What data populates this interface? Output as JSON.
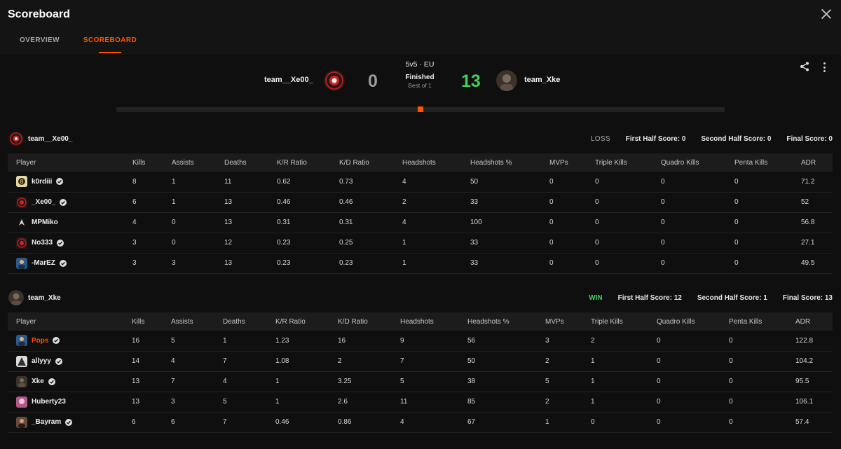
{
  "header": {
    "title": "Scoreboard"
  },
  "tabs": [
    {
      "label": "OVERVIEW",
      "active": false
    },
    {
      "label": "SCOREBOARD",
      "active": true
    }
  ],
  "match": {
    "format": "5v5 · EU",
    "status": "Finished",
    "best_of": "Best of 1",
    "team1": {
      "name": "team__Xe00_",
      "score": "0"
    },
    "team2": {
      "name": "team_Xke",
      "score": "13"
    },
    "colors": {
      "accent": "#ff5500",
      "win": "#3fd15b",
      "loss_score": "#9b9b9b"
    }
  },
  "columns": [
    "Player",
    "Kills",
    "Assists",
    "Deaths",
    "K/R Ratio",
    "K/D Ratio",
    "Headshots",
    "Headshots %",
    "MVPs",
    "Triple Kills",
    "Quadro Kills",
    "Penta Kills",
    "ADR"
  ],
  "teams": [
    {
      "name": "team__Xe00_",
      "result": "LOSS",
      "first_half": "First Half Score: 0",
      "second_half": "Second Half Score: 0",
      "final": "Final Score: 0",
      "players": [
        {
          "name": "k0rdiii",
          "verified": true,
          "highlight": false,
          "avatar": "gold",
          "stats": [
            "8",
            "1",
            "11",
            "0.62",
            "0.73",
            "4",
            "50",
            "0",
            "0",
            "0",
            "0",
            "71.2"
          ]
        },
        {
          "name": "_Xe00_",
          "verified": true,
          "highlight": false,
          "avatar": "red",
          "stats": [
            "6",
            "1",
            "13",
            "0.46",
            "0.46",
            "2",
            "33",
            "0",
            "0",
            "0",
            "0",
            "52"
          ]
        },
        {
          "name": "MPMiko",
          "verified": false,
          "highlight": false,
          "avatar": "wings",
          "stats": [
            "4",
            "0",
            "13",
            "0.31",
            "0.31",
            "4",
            "100",
            "0",
            "0",
            "0",
            "0",
            "56.8"
          ]
        },
        {
          "name": "No333",
          "verified": true,
          "highlight": false,
          "avatar": "red",
          "stats": [
            "3",
            "0",
            "12",
            "0.23",
            "0.25",
            "1",
            "33",
            "0",
            "0",
            "0",
            "0",
            "27.1"
          ]
        },
        {
          "name": "-MarEZ",
          "verified": true,
          "highlight": false,
          "avatar": "blue",
          "stats": [
            "3",
            "3",
            "13",
            "0.23",
            "0.23",
            "1",
            "33",
            "0",
            "0",
            "0",
            "0",
            "49.5"
          ]
        }
      ]
    },
    {
      "name": "team_Xke",
      "result": "WIN",
      "first_half": "First Half Score: 12",
      "second_half": "Second Half Score: 1",
      "final": "Final Score: 13",
      "players": [
        {
          "name": "Pops",
          "verified": true,
          "highlight": true,
          "avatar": "blue",
          "stats": [
            "16",
            "5",
            "1",
            "1.23",
            "16",
            "9",
            "56",
            "3",
            "2",
            "0",
            "0",
            "122.8"
          ]
        },
        {
          "name": "allyyy",
          "verified": true,
          "highlight": false,
          "avatar": "mono",
          "stats": [
            "14",
            "4",
            "7",
            "1.08",
            "2",
            "7",
            "50",
            "2",
            "1",
            "0",
            "0",
            "104.2"
          ]
        },
        {
          "name": "Xke",
          "verified": true,
          "highlight": false,
          "avatar": "dark",
          "stats": [
            "13",
            "7",
            "4",
            "1",
            "3.25",
            "5",
            "38",
            "5",
            "1",
            "0",
            "0",
            "95.5"
          ]
        },
        {
          "name": "Huberty23",
          "verified": false,
          "highlight": false,
          "avatar": "pink",
          "stats": [
            "13",
            "3",
            "5",
            "1",
            "2.6",
            "11",
            "85",
            "2",
            "1",
            "0",
            "0",
            "106.1"
          ]
        },
        {
          "name": "_Bayram",
          "verified": true,
          "highlight": false,
          "avatar": "brown",
          "stats": [
            "6",
            "6",
            "7",
            "0.46",
            "0.86",
            "4",
            "67",
            "1",
            "0",
            "0",
            "0",
            "57.4"
          ]
        }
      ]
    }
  ]
}
